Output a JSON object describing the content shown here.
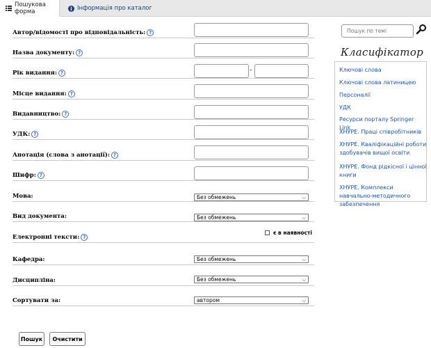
{
  "tabs": {
    "search_form": "Пошукова форма",
    "catalog_info": "Інформація про каталог"
  },
  "form": {
    "help_glyph": "?",
    "author_label": "Автор/відомості про відповідальність:",
    "title_label": "Назва документу:",
    "year_label": "Рік видання:",
    "year_separator": "-",
    "place_label": "Місце видання:",
    "publisher_label": "Видавництво:",
    "udk_label": "УДК:",
    "annotation_label": "Анотація (слова з анотації):",
    "cipher_label": "Шифр:",
    "language_label": "Мова:",
    "language_value": "Без обмежень",
    "doctype_label": "Вид документа:",
    "doctype_value": "Без обмежень",
    "etexts_label": "Електронні тексти:",
    "available_label": "є в наявності",
    "department_label": "Кафедра:",
    "department_value": "Без обмежень",
    "discipline_label": "Дисципліна:",
    "discipline_value": "Без обмежень",
    "sort_label": "Сортувати за:",
    "sort_value": "автором"
  },
  "buttons": {
    "search": "Пошук",
    "clear": "Очистити"
  },
  "sidebar": {
    "search_placeholder": "Пошук по темі",
    "classifier_title": "Класифікатор",
    "items": [
      "Ключові слова",
      "Ключові слова латиницею",
      "Персоналії",
      "УДК",
      "Ресурси порталу Springer Link",
      "ХНУРЕ. Праці співробітників",
      "ХНУРЕ. Кваліфікаційні роботи здобувачів вищої освіти",
      "ХНУРЕ. Фонд рідкісної і цінної книги",
      "ХНУРЕ. Комплекси навчально-методичного забезпечення"
    ]
  },
  "colors": {
    "link": "#1a56b8",
    "tab_link": "#1a3f8a",
    "help_icon": "#3a6bc8"
  }
}
